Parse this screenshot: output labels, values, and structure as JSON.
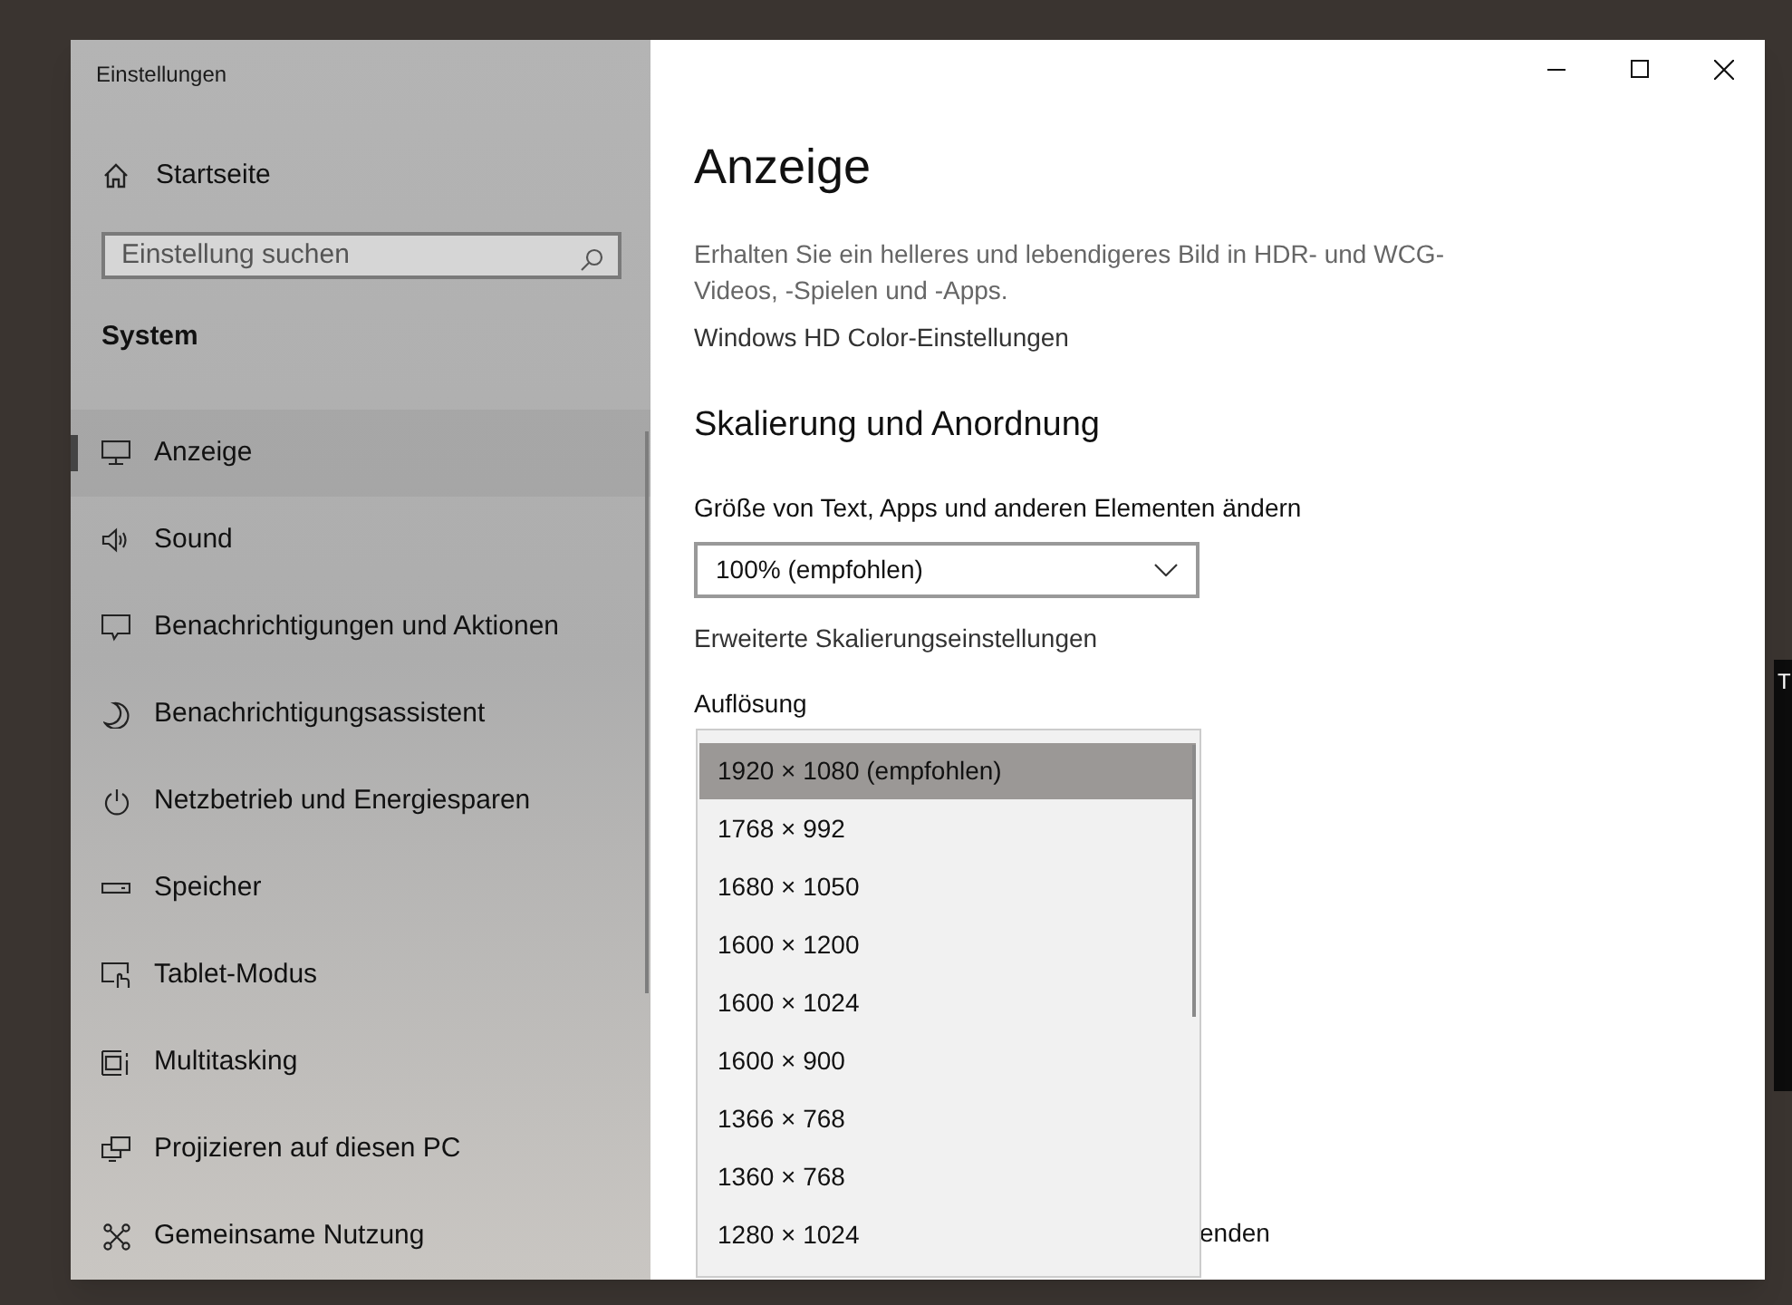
{
  "window": {
    "title": "Einstellungen"
  },
  "sidebar": {
    "home": "Startseite",
    "search": {
      "placeholder": "Einstellung suchen"
    },
    "section": "System",
    "items": [
      {
        "label": "Anzeige",
        "selected": true
      },
      {
        "label": "Sound",
        "selected": false
      },
      {
        "label": "Benachrichtigungen und Aktionen",
        "selected": false
      },
      {
        "label": "Benachrichtigungsassistent",
        "selected": false
      },
      {
        "label": "Netzbetrieb und Energiesparen",
        "selected": false
      },
      {
        "label": "Speicher",
        "selected": false
      },
      {
        "label": "Tablet-Modus",
        "selected": false
      },
      {
        "label": "Multitasking",
        "selected": false
      },
      {
        "label": "Projizieren auf diesen PC",
        "selected": false
      },
      {
        "label": "Gemeinsame Nutzung",
        "selected": false
      }
    ]
  },
  "main": {
    "title": "Anzeige",
    "hdr_text": "Erhalten Sie ein helleres und lebendigeres Bild in HDR- und WCG-Videos, -Spielen und -Apps.",
    "hdr_link": "Windows HD Color-Einstellungen",
    "section": "Skalierung und Anordnung",
    "scale_label": "Größe von Text, Apps und anderen Elementen ändern",
    "scale_value": "100% (empfohlen)",
    "advanced_link": "Erweiterte Skalierungseinstellungen",
    "resolution_label": "Auflösung",
    "covered_text": "enden",
    "resolution_options": [
      {
        "label": "1920 × 1080 (empfohlen)",
        "selected": true
      },
      {
        "label": "1768 × 992",
        "selected": false
      },
      {
        "label": "1680 × 1050",
        "selected": false
      },
      {
        "label": "1600 × 1200",
        "selected": false
      },
      {
        "label": "1600 × 1024",
        "selected": false
      },
      {
        "label": "1600 × 900",
        "selected": false
      },
      {
        "label": "1366 × 768",
        "selected": false
      },
      {
        "label": "1360 × 768",
        "selected": false
      },
      {
        "label": "1280 × 1024",
        "selected": false
      }
    ]
  },
  "desktop": {
    "edge_text": "T"
  }
}
